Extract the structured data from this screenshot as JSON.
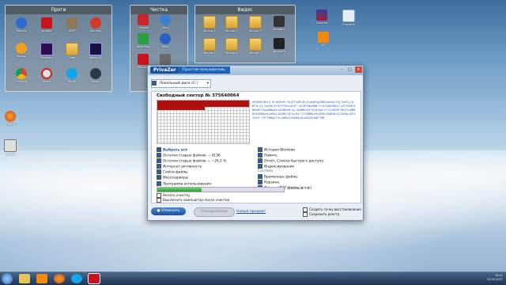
{
  "desktop": {
    "fences": [
      {
        "title": "Проги"
      },
      {
        "title": "Чистка"
      },
      {
        "title": "Видос"
      }
    ],
    "progi_icons": [
      "Яндекс",
      "Acrobat",
      "GIMP",
      "Daemon",
      "Ярлык",
      "Premiere",
      "Total",
      "Adobe AE",
      "Chrome",
      "Opera",
      "Skype",
      "Steam"
    ],
    "chistka_icons": [
      "Ccleaner",
      "Glary",
      "Wise Reg",
      "Revo",
      "Privazer",
      "Disk"
    ],
    "video_icons": [
      "Фильм 1",
      "Фильм 2",
      "Фильм 3",
      "Фильм 4",
      "Фильм 5",
      "Фильм 6",
      "Фильм 7",
      "Фильм 8",
      "Фильм 9"
    ],
    "right_icons": [
      "Сжатие",
      "Корзина",
      "VLC"
    ],
    "left_icons": [
      "Firefox",
      "Архив"
    ]
  },
  "privazer": {
    "brand": "PrivaZer",
    "mode_label": "Простой пользователь",
    "drive_label": "Локальный диск (C:)",
    "sector_title": "Свободный сектор № 375640064",
    "hex_dump": "e0Sa4P4Rz4-W~0u8n9~*0{dTu4R+8n{Lgd#1g2R84uAn0+*&{?a02{+0W?d;sy_kwF#/4l0?1*Qa+@u9^-kL3Ps8w9#0~t+a!&@A5Dk2~+0?XvW14Dbe8?c&sqB8p#n+ASDDA8~a+~&0B8vA4^8+8rAo^n?c+H3z8^&R47+#B0Ds9z8Nwzd+e9b+1AvBsl8^q+Hs~17?#B0Dz9z8v0+E&Nc8+kJ1hRp+8F4*0s9~?fF*B0A4~tLz8#k2+8aD0z8+A&1R4o8F?@B",
    "left_options": [
      {
        "label": "Выбрать всё",
        "header": true
      },
      {
        "label": "Остатки старых файлов — 4136"
      },
      {
        "label": "Остатки старых файлов — ~26,1 %"
      },
      {
        "label": "Интернет-активность"
      },
      {
        "label": "Cookie-файлы"
      },
      {
        "label": "Мессенджеры"
      },
      {
        "label": "Программа использования"
      },
      {
        "label": "Реестр"
      }
    ],
    "right_options": [
      {
        "label": "История Windows"
      },
      {
        "label": "Память"
      },
      {
        "label": "Отчёт, Списки быстрого доступа"
      },
      {
        "label": "Индексирование"
      },
      {
        "label": "Система",
        "header": true
      },
      {
        "label": "Временные файлы"
      },
      {
        "label": "Корзина"
      },
      {
        "label": "Другое (ЛОГ-файлы и т.п.)"
      }
    ],
    "progress_percent": 35,
    "time_left": "14 мин. 26 сек.",
    "after_options": [
      "Начать очистку",
      "Выключить компьютер после очистки"
    ],
    "cancel_label": "Отменить",
    "scan_label": "Сканирование",
    "new_scan_link": "Новый предмет",
    "restore_options": [
      "Создать точку восстановления",
      "Сохранить реестр"
    ]
  },
  "taskbar": {
    "clock_time": "19:11",
    "clock_date": "22.03.2017"
  },
  "colors": {
    "accent": "#1d63b8",
    "sector_used": "#b40f0f",
    "progress": "#2e9e2e"
  }
}
